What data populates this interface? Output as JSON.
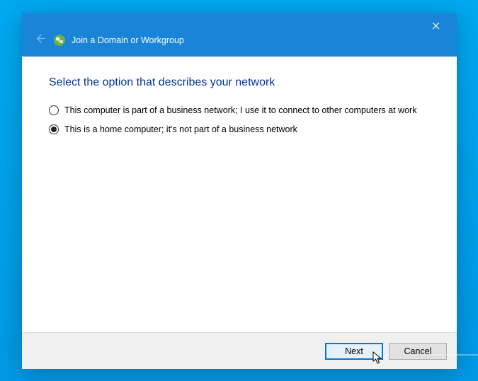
{
  "window": {
    "title": "Join a Domain or Workgroup"
  },
  "main": {
    "heading": "Select the option that describes your network",
    "options": [
      {
        "label": "This computer is part of a business network; I use it to connect to other computers at work",
        "selected": false
      },
      {
        "label": "This is a home computer; it's not part of a business network",
        "selected": true
      }
    ]
  },
  "footer": {
    "next": "Next",
    "cancel": "Cancel"
  },
  "icons": {
    "close": "close-icon",
    "back": "back-arrow-icon",
    "wizard": "domain-workgroup-icon"
  }
}
